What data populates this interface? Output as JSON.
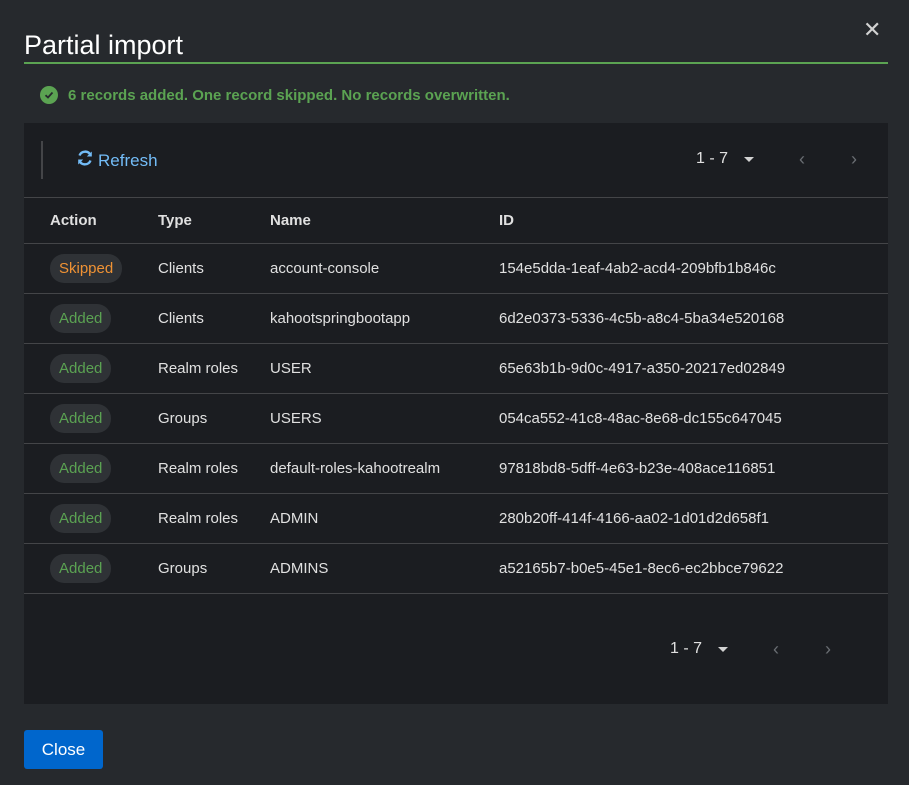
{
  "modal": {
    "title": "Partial import",
    "close_icon": "close-icon"
  },
  "alert": {
    "message": "6 records added. One record skipped. No records overwritten.",
    "icon": "check-circle-icon",
    "color": "#5ba352"
  },
  "toolbar": {
    "refresh_label": "Refresh",
    "refresh_icon": "sync-icon"
  },
  "pagination": {
    "range": "1 - 7"
  },
  "table": {
    "headers": [
      "Action",
      "Type",
      "Name",
      "ID"
    ],
    "rows": [
      {
        "action": "Skipped",
        "type": "Clients",
        "name": "account-console",
        "id": "154e5dda-1eaf-4ab2-acd4-209bfb1b846c"
      },
      {
        "action": "Added",
        "type": "Clients",
        "name": "kahootspringbootapp",
        "id": "6d2e0373-5336-4c5b-a8c4-5ba34e520168"
      },
      {
        "action": "Added",
        "type": "Realm roles",
        "name": "USER",
        "id": "65e63b1b-9d0c-4917-a350-20217ed02849"
      },
      {
        "action": "Added",
        "type": "Groups",
        "name": "USERS",
        "id": "054ca552-41c8-48ac-8e68-dc155c647045"
      },
      {
        "action": "Added",
        "type": "Realm roles",
        "name": "default-roles-kahootrealm",
        "id": "97818bd8-5dff-4e63-b23e-408ace116851"
      },
      {
        "action": "Added",
        "type": "Realm roles",
        "name": "ADMIN",
        "id": "280b20ff-414f-4166-aa02-1d01d2d658f1"
      },
      {
        "action": "Added",
        "type": "Groups",
        "name": "ADMINS",
        "id": "a52165b7-b0e5-45e1-8ec6-ec2bbce79622"
      }
    ]
  },
  "footer": {
    "close_label": "Close"
  },
  "colors": {
    "accent": "#0066cc",
    "added": "#5ba352",
    "skipped": "#ef9234",
    "link": "#73bcf7"
  }
}
